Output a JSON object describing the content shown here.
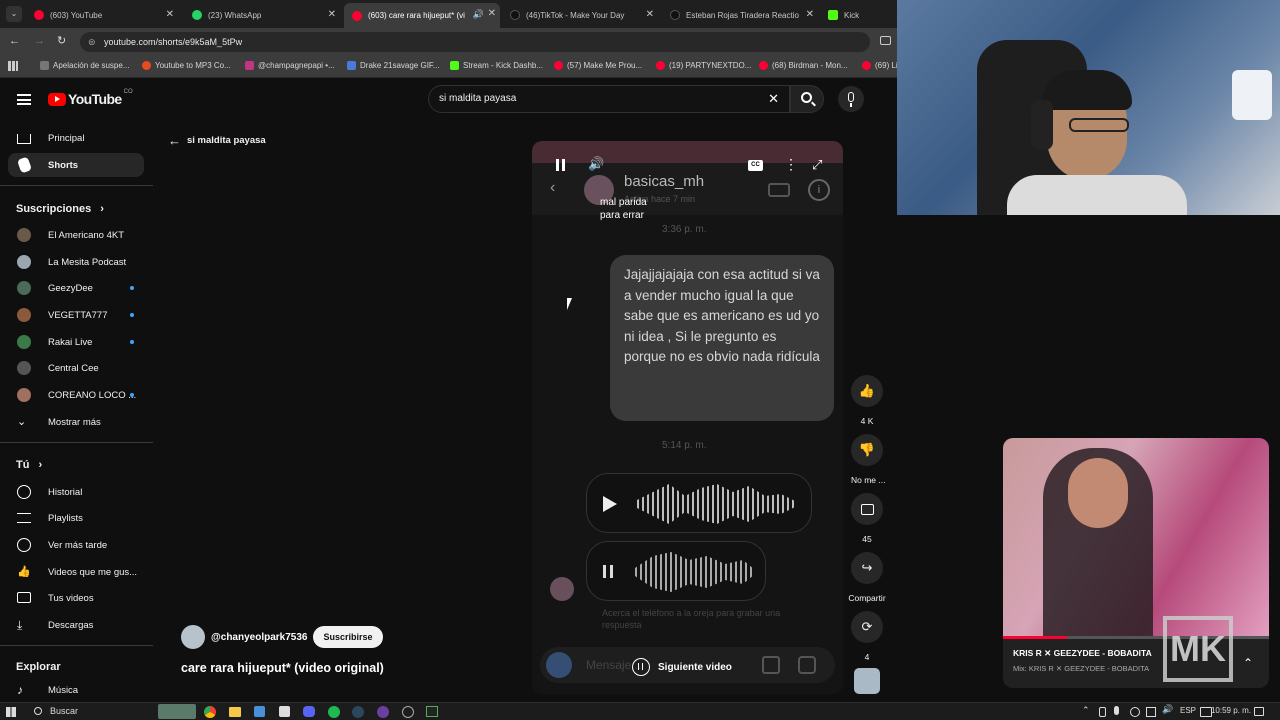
{
  "tabs": [
    {
      "label": "(603) YouTube",
      "color": "#ff0033"
    },
    {
      "label": "(23) WhatsApp",
      "color": "#25d366"
    },
    {
      "label": "(603) care rara hijueput* (vi",
      "color": "#ff0033"
    },
    {
      "label": "(46)TikTok - Make Your Day",
      "color": "#111111"
    },
    {
      "label": "Esteban Rojas Tiradera Reactio",
      "color": "#111111"
    },
    {
      "label": "Kick",
      "color": "#53fc18"
    }
  ],
  "address": "youtube.com/shorts/e9k5aM_5tPw",
  "bookmarks": [
    {
      "label": "Apelación de suspe...",
      "color": "#777777"
    },
    {
      "label": "Youtube to MP3 Co...",
      "color": "#e94a1f"
    },
    {
      "label": "@champagnepapi •...",
      "color": "#c13584"
    },
    {
      "label": "Drake 21savage GIF...",
      "color": "#4a7bd6"
    },
    {
      "label": "Stream - Kick Dashb...",
      "color": "#53fc18"
    },
    {
      "label": "(57) Make Me Prou...",
      "color": "#ff0033"
    },
    {
      "label": "(19) PARTYNEXTDO...",
      "color": "#ff0033"
    },
    {
      "label": "(68) Birdman - Mon...",
      "color": "#ff0033"
    },
    {
      "label": "(69) Li",
      "color": "#ff0033"
    }
  ],
  "header": {
    "logo": "YouTube",
    "country": "CO",
    "search_value": "si maldita payasa"
  },
  "sidebar": {
    "main": [
      {
        "label": "Principal",
        "icon": "home-icon"
      },
      {
        "label": "Shorts",
        "icon": "shorts-icon"
      }
    ],
    "subs_title": "Suscripciones",
    "subs": [
      {
        "label": "El Americano 4KT",
        "color": "#6b5a4a",
        "dot": false
      },
      {
        "label": "La Mesita Podcast",
        "color": "#9aa7b0",
        "dot": false
      },
      {
        "label": "GeezyDee",
        "color": "#4a6a5a",
        "dot": true
      },
      {
        "label": "VEGETTA777",
        "color": "#8a5a3a",
        "dot": true
      },
      {
        "label": "Rakai Live",
        "color": "#3a7a4a",
        "dot": true
      },
      {
        "label": "Central Cee",
        "color": "#555555",
        "dot": false
      },
      {
        "label": "COREANO LOCO ...",
        "color": "#a07060",
        "dot": true
      }
    ],
    "more": "Mostrar más",
    "you_title": "Tú",
    "you": [
      {
        "label": "Historial",
        "icon": "history-icon"
      },
      {
        "label": "Playlists",
        "icon": "playlists-icon"
      },
      {
        "label": "Ver más tarde",
        "icon": "watch-later-icon"
      },
      {
        "label": "Videos que me gus...",
        "icon": "like-icon"
      },
      {
        "label": "Tus videos",
        "icon": "your-videos-icon"
      },
      {
        "label": "Descargas",
        "icon": "download-icon"
      }
    ],
    "explore_title": "Explorar",
    "explore": [
      {
        "label": "Música",
        "icon": "music-icon"
      }
    ]
  },
  "back_label": "si maldita payasa",
  "short": {
    "chat_name": "basicas_mh",
    "chat_status": "Activa hace 7 min",
    "caption": "mal parida para errar",
    "time1": "3:36 p. m.",
    "message": "Jajajjajajaja con esa actitud si va a vender mucho igual la que sabe que es americano es ud yo ni idea , Si le pregunto es porque no es obvio nada ridícula",
    "time2": "5:14 p. m.",
    "hint": "Acerca el teléfono a la oreja para grabar una respuesta",
    "input": "Mensaje...",
    "next_label": "Siguiente video",
    "channel": "@chanyeolpark7536",
    "subscribe": "Suscribirse",
    "title": "care rara hijueput* (video original)"
  },
  "actions": {
    "likes": "4 K",
    "dislike": "No me ...",
    "comments": "45",
    "share": "Compartir",
    "remix": "4"
  },
  "music": {
    "title": "KRIS R ✕ GEEZYDEE - BOBADITA",
    "subtitle": "Mix: KRIS R ✕ GEEZYDEE - BOBADITA",
    "badge": "MK"
  },
  "taskbar": {
    "search": "Buscar",
    "lang": "ESP",
    "time": "10:59 p. m."
  }
}
